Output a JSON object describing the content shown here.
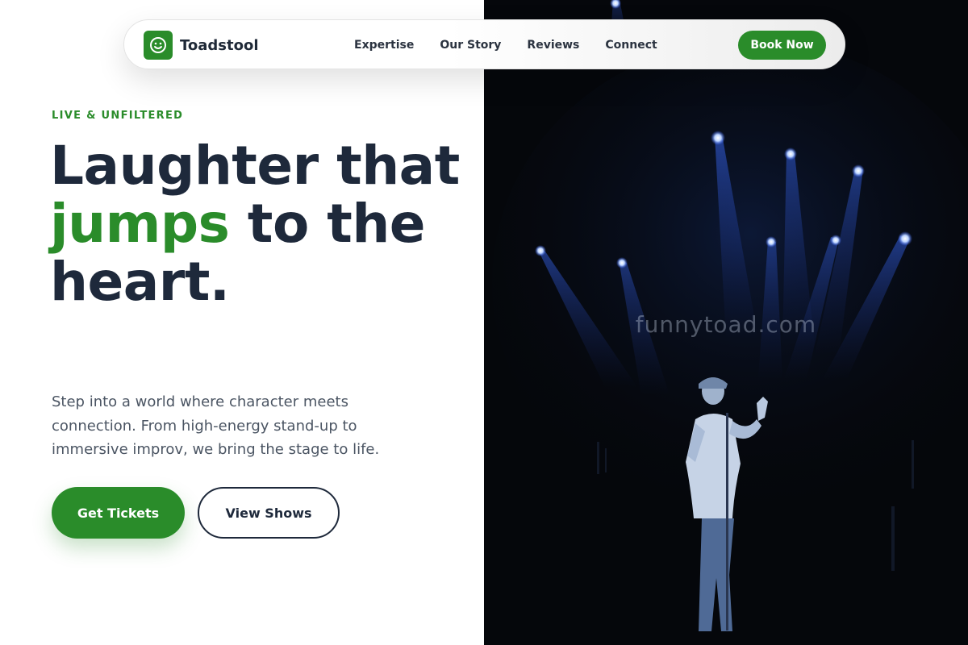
{
  "brand": {
    "name": "Toadstool",
    "icon": "smiley-icon"
  },
  "nav": {
    "items": [
      {
        "label": "Expertise"
      },
      {
        "label": "Our Story"
      },
      {
        "label": "Reviews"
      },
      {
        "label": "Connect"
      }
    ],
    "cta_label": "Book Now"
  },
  "hero": {
    "eyebrow": "LIVE & UNFILTERED",
    "headline_part1": "Laughter that ",
    "headline_accent": "jumps",
    "headline_part2": " to the heart.",
    "lede": "Step into a world where character meets connection. From high-energy stand-up to immersive improv, we bring the stage to life.",
    "primary_button": "Get Tickets",
    "secondary_button": "View Shows"
  },
  "photo": {
    "subject": "comedian-on-stage-image",
    "watermark": "funnytoad.com"
  },
  "colors": {
    "accent": "#2a8c2a",
    "ink": "#1e293b",
    "body": "#4b5563",
    "photo_bg": "#05070b"
  }
}
